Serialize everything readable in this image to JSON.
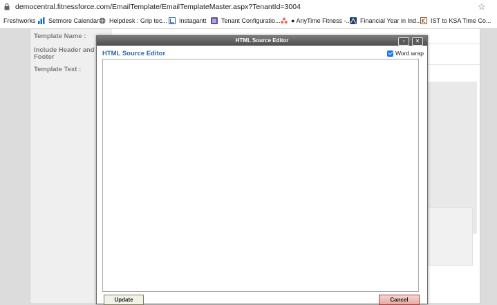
{
  "browser": {
    "url": "democentral.fitnessforce.com/EmailTemplate/EmailTemplateMaster.aspx?TenantId=3004",
    "bookmarks": [
      {
        "label": "Freshworks"
      },
      {
        "label": "Setmore Calendar"
      },
      {
        "label": "Helpdesk : Grip tec..."
      },
      {
        "label": "Instagantt"
      },
      {
        "label": "Tenant Configuratio..."
      },
      {
        "label": "AnyTime Fitness -..."
      },
      {
        "label": "Financial Year in Ind..."
      },
      {
        "label": "IST to KSA Time Co..."
      }
    ]
  },
  "form": {
    "template_name_label": "Template Name :",
    "include_header_label_1": "Include Header and",
    "include_header_label_2": "Footer",
    "template_text_label": "Template Text :"
  },
  "dialog": {
    "title": "HTML Source Editor",
    "heading": "HTML Source Editor",
    "word_wrap_label": "Word wrap",
    "word_wrap_checked": true,
    "editor_value": "",
    "update_label": "Update",
    "cancel_label": "Cancel"
  },
  "colors": {
    "dialog_heading": "#2a64a8",
    "checkbox": "#1a73e8",
    "cancel_button": "#e8a8a0"
  }
}
